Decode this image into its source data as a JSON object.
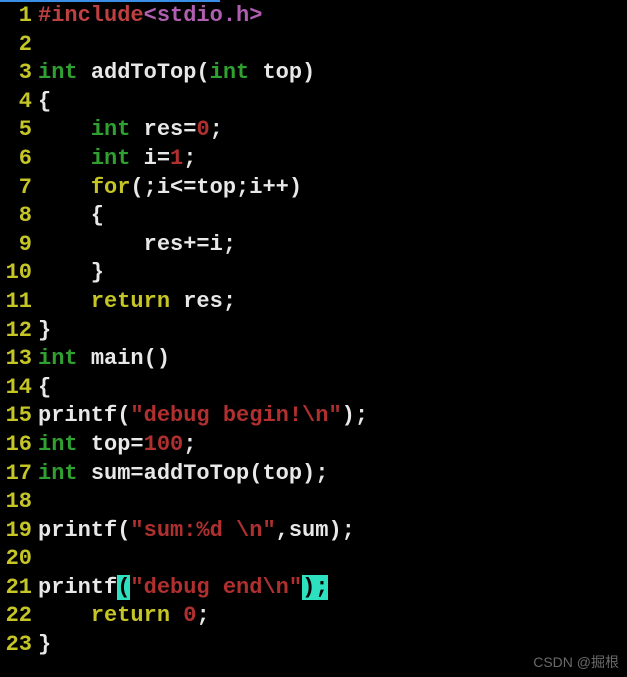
{
  "watermark": "CSDN @掘根",
  "lines": [
    {
      "n": "1",
      "tokens": [
        {
          "t": "#include",
          "c": "c-pre"
        },
        {
          "t": "<stdio.h>",
          "c": "c-head"
        }
      ]
    },
    {
      "n": "2",
      "tokens": []
    },
    {
      "n": "3",
      "tokens": [
        {
          "t": "int ",
          "c": "c-type"
        },
        {
          "t": "addToTop(",
          "c": "c-white"
        },
        {
          "t": "int ",
          "c": "c-type"
        },
        {
          "t": "top)",
          "c": "c-white"
        }
      ]
    },
    {
      "n": "4",
      "tokens": [
        {
          "t": "{",
          "c": "c-white"
        }
      ]
    },
    {
      "n": "5",
      "tokens": [
        {
          "t": "    ",
          "c": "c-white"
        },
        {
          "t": "int ",
          "c": "c-type"
        },
        {
          "t": "res=",
          "c": "c-white"
        },
        {
          "t": "0",
          "c": "c-num"
        },
        {
          "t": ";",
          "c": "c-white"
        }
      ]
    },
    {
      "n": "6",
      "tokens": [
        {
          "t": "    ",
          "c": "c-white"
        },
        {
          "t": "int ",
          "c": "c-type"
        },
        {
          "t": "i=",
          "c": "c-white"
        },
        {
          "t": "1",
          "c": "c-num"
        },
        {
          "t": ";",
          "c": "c-white"
        }
      ]
    },
    {
      "n": "7",
      "tokens": [
        {
          "t": "    ",
          "c": "c-white"
        },
        {
          "t": "for",
          "c": "c-kw"
        },
        {
          "t": "(;i<=top;i++)",
          "c": "c-white"
        }
      ]
    },
    {
      "n": "8",
      "tokens": [
        {
          "t": "    {",
          "c": "c-white"
        }
      ]
    },
    {
      "n": "9",
      "tokens": [
        {
          "t": "        res+=i;",
          "c": "c-white"
        }
      ]
    },
    {
      "n": "10",
      "tokens": [
        {
          "t": "    }",
          "c": "c-white"
        }
      ]
    },
    {
      "n": "11",
      "tokens": [
        {
          "t": "    ",
          "c": "c-white"
        },
        {
          "t": "return ",
          "c": "c-kw"
        },
        {
          "t": "res;",
          "c": "c-white"
        }
      ]
    },
    {
      "n": "12",
      "tokens": [
        {
          "t": "}",
          "c": "c-white"
        }
      ]
    },
    {
      "n": "13",
      "tokens": [
        {
          "t": "int ",
          "c": "c-type"
        },
        {
          "t": "main()",
          "c": "c-white"
        }
      ]
    },
    {
      "n": "14",
      "tokens": [
        {
          "t": "{",
          "c": "c-white"
        }
      ]
    },
    {
      "n": "15",
      "tokens": [
        {
          "t": "printf(",
          "c": "c-white"
        },
        {
          "t": "\"debug begin!\\n\"",
          "c": "c-str"
        },
        {
          "t": ");",
          "c": "c-white"
        }
      ]
    },
    {
      "n": "16",
      "tokens": [
        {
          "t": "int ",
          "c": "c-type"
        },
        {
          "t": "top=",
          "c": "c-white"
        },
        {
          "t": "100",
          "c": "c-num"
        },
        {
          "t": ";",
          "c": "c-white"
        }
      ]
    },
    {
      "n": "17",
      "tokens": [
        {
          "t": "int ",
          "c": "c-type"
        },
        {
          "t": "sum=addToTop(top);",
          "c": "c-white"
        }
      ]
    },
    {
      "n": "18",
      "tokens": []
    },
    {
      "n": "19",
      "tokens": [
        {
          "t": "printf(",
          "c": "c-white"
        },
        {
          "t": "\"sum:%d \\n\"",
          "c": "c-str"
        },
        {
          "t": ",sum);",
          "c": "c-white"
        }
      ]
    },
    {
      "n": "20",
      "tokens": []
    },
    {
      "n": "21",
      "tokens": [
        {
          "t": "printf",
          "c": "c-white"
        },
        {
          "t": "(",
          "c": "hl-cyan"
        },
        {
          "t": "\"debug end\\n\"",
          "c": "c-str"
        },
        {
          "t": ")",
          "c": "hl-cyan"
        },
        {
          "t": ";",
          "c": "hl-cyan"
        }
      ]
    },
    {
      "n": "22",
      "tokens": [
        {
          "t": "    ",
          "c": "c-white"
        },
        {
          "t": "return ",
          "c": "c-kw"
        },
        {
          "t": "0",
          "c": "c-num"
        },
        {
          "t": ";",
          "c": "c-white"
        }
      ]
    },
    {
      "n": "23",
      "tokens": [
        {
          "t": "}",
          "c": "c-white"
        }
      ]
    }
  ]
}
